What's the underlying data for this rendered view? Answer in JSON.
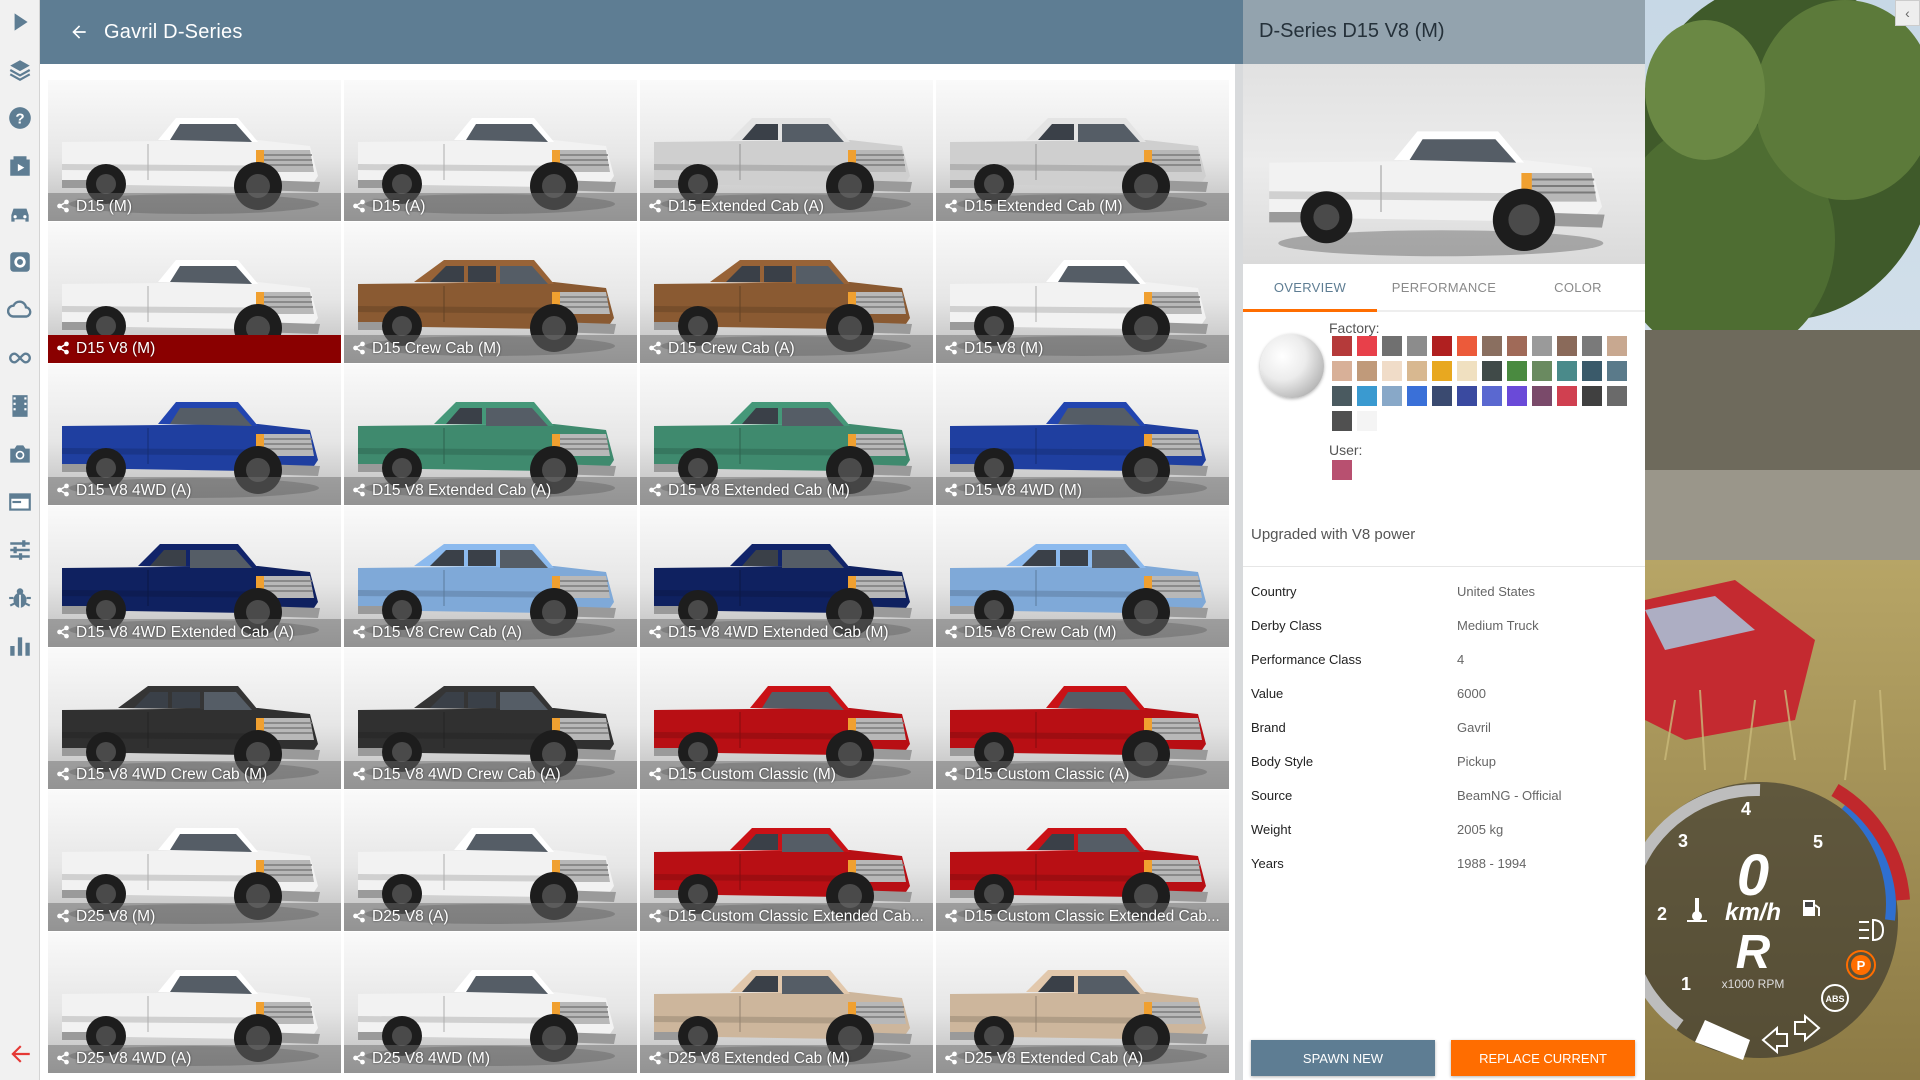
{
  "header": {
    "title": "Gavril D-Series",
    "back_icon": "arrow-left-icon"
  },
  "sidebar": {
    "items": [
      {
        "name": "play-icon"
      },
      {
        "name": "layers-icon"
      },
      {
        "name": "help-icon"
      },
      {
        "name": "scenarios-icon"
      },
      {
        "name": "vehicles-icon"
      },
      {
        "name": "vehicle-config-icon"
      },
      {
        "name": "environment-icon"
      },
      {
        "name": "infinity-icon"
      },
      {
        "name": "film-icon"
      },
      {
        "name": "camera-icon"
      },
      {
        "name": "window-icon"
      },
      {
        "name": "settings-sliders-icon"
      },
      {
        "name": "debug-icon"
      },
      {
        "name": "performance-graph-icon"
      }
    ],
    "exit_icon": "exit-arrow-icon"
  },
  "configs": [
    {
      "label": "D15 (M)",
      "color": "#f2f2f2",
      "cab": "regular"
    },
    {
      "label": "D15 (A)",
      "color": "#f2f2f2",
      "cab": "regular"
    },
    {
      "label": "D15 Extended Cab (A)",
      "color": "#cfcfcf",
      "cab": "extended"
    },
    {
      "label": "D15 Extended Cab (M)",
      "color": "#cfcfcf",
      "cab": "extended"
    },
    {
      "label": "D15 V8 (M)",
      "color": "#f2f2f2",
      "cab": "regular"
    },
    {
      "label": "D15 Crew Cab (M)",
      "color": "#8a5a32",
      "cab": "crew"
    },
    {
      "label": "D15 Crew Cab (A)",
      "color": "#8a5a32",
      "cab": "crew"
    },
    {
      "label": "D15 V8 (M)",
      "color": "#f2f2f2",
      "cab": "regular"
    },
    {
      "label": "D15 V8 4WD (A)",
      "color": "#1f3fa0",
      "cab": "regular"
    },
    {
      "label": "D15 V8 Extended Cab (A)",
      "color": "#3f8a6e",
      "cab": "extended"
    },
    {
      "label": "D15 V8 Extended Cab (M)",
      "color": "#3f8a6e",
      "cab": "extended"
    },
    {
      "label": "D15 V8 4WD (M)",
      "color": "#1f3fa0",
      "cab": "regular"
    },
    {
      "label": "D15 V8 4WD Extended Cab (A)",
      "color": "#0f2160",
      "cab": "extended"
    },
    {
      "label": "D15 V8 Crew Cab (A)",
      "color": "#7fa9d8",
      "cab": "crew"
    },
    {
      "label": "D15 V8 4WD Extended Cab (M)",
      "color": "#0f2160",
      "cab": "extended"
    },
    {
      "label": "D15 V8 Crew Cab (M)",
      "color": "#7fa9d8",
      "cab": "crew"
    },
    {
      "label": "D15 V8 4WD Crew Cab (M)",
      "color": "#303030",
      "cab": "crew"
    },
    {
      "label": "D15 V8 4WD Crew Cab (A)",
      "color": "#303030",
      "cab": "crew"
    },
    {
      "label": "D15 Custom Classic (M)",
      "color": "#b80f14",
      "cab": "regular"
    },
    {
      "label": "D15 Custom Classic (A)",
      "color": "#b80f14",
      "cab": "regular"
    },
    {
      "label": "D25 V8 (M)",
      "color": "#f2f2f2",
      "cab": "regular"
    },
    {
      "label": "D25 V8 (A)",
      "color": "#f2f2f2",
      "cab": "regular"
    },
    {
      "label": "D15 Custom Classic Extended Cab...",
      "color": "#b80f14",
      "cab": "extended"
    },
    {
      "label": "D15 Custom Classic Extended Cab...",
      "color": "#b80f14",
      "cab": "extended"
    },
    {
      "label": "D25 V8 4WD (A)",
      "color": "#f2f2f2",
      "cab": "regular"
    },
    {
      "label": "D25 V8 4WD (M)",
      "color": "#f2f2f2",
      "cab": "regular"
    },
    {
      "label": "D25 V8 Extended Cab (M)",
      "color": "#cdb69c",
      "cab": "extended"
    },
    {
      "label": "D25 V8 Extended Cab (A)",
      "color": "#cdb69c",
      "cab": "extended"
    }
  ],
  "selected_index": 4,
  "panel": {
    "title": "D-Series D15 V8 (M)",
    "tabs": [
      "OVERVIEW",
      "PERFORMANCE",
      "COLOR"
    ],
    "active_tab": 0,
    "factory_label": "Factory:",
    "user_label": "User:",
    "factory_colors": [
      "#b53a3a",
      "#e8404a",
      "#707070",
      "#8c8c8c",
      "#b02020",
      "#ec5a3a",
      "#8a6f60",
      "#a06a58",
      "#9a9a9a",
      "#8a6a5a",
      "#7a7a7a",
      "#c8a890",
      "#d8b098",
      "#c09a7a",
      "#f0dcc8",
      "#d8b890",
      "#e8a820",
      "#f0e0c0",
      "#404a48",
      "#4a8a40",
      "#6a8a60",
      "#4a8a8a",
      "#3a5a6a",
      "#5a7a8a",
      "#4a5a60",
      "#3a9ad0",
      "#88a8c8",
      "#3a70d8",
      "#3a4a70",
      "#3a4aa0",
      "#5a68d0",
      "#6a4ad8",
      "#7a4a6a",
      "#d04050",
      "#404040",
      "#6a6a6a",
      "#505050",
      "#f4f4f4"
    ],
    "user_colors": [
      "#b85070"
    ],
    "description": "Upgraded with V8 power",
    "specs": [
      {
        "key": "Country",
        "value": "United States"
      },
      {
        "key": "Derby Class",
        "value": "Medium Truck"
      },
      {
        "key": "Performance Class",
        "value": "4"
      },
      {
        "key": "Value",
        "value": "6000"
      },
      {
        "key": "Brand",
        "value": "Gavril"
      },
      {
        "key": "Body Style",
        "value": "Pickup"
      },
      {
        "key": "Source",
        "value": "BeamNG - Official"
      },
      {
        "key": "Weight",
        "value": "2005 kg"
      },
      {
        "key": "Years",
        "value": "1988 - 1994"
      }
    ],
    "spawn_label": "SPAWN NEW",
    "replace_label": "REPLACE CURRENT",
    "preview_color": "#f2f2f2"
  },
  "hud": {
    "speed": "0",
    "speed_unit": "km/h",
    "gear": "R",
    "rpm_unit": "x1000 RPM",
    "tach_labels": [
      "1",
      "2",
      "3",
      "4",
      "5"
    ],
    "abs_label": "ABS",
    "parking_label": "P"
  },
  "collapse_icon": "chevron-left-icon"
}
